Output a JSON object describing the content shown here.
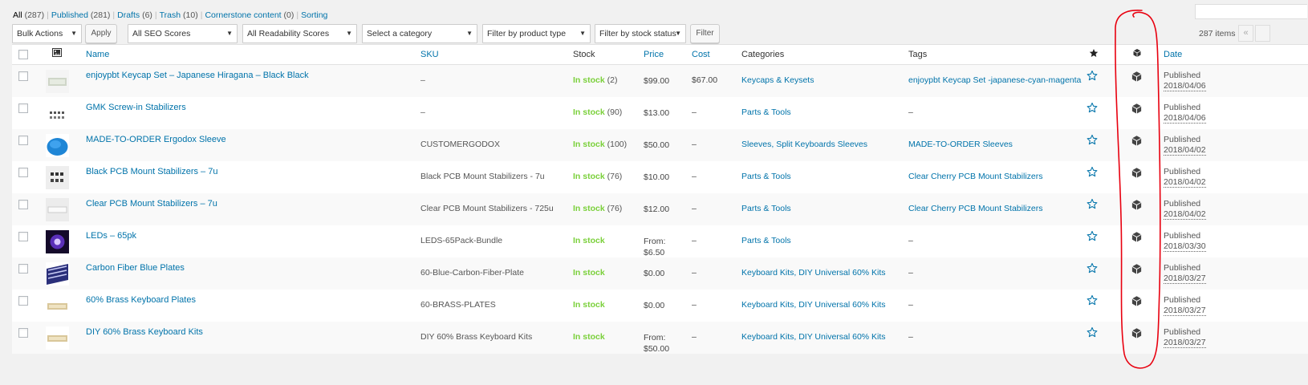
{
  "status_links": [
    {
      "label": "All",
      "count": "(287)",
      "current": true
    },
    {
      "label": "Published",
      "count": "(281)"
    },
    {
      "label": "Drafts",
      "count": "(6)"
    },
    {
      "label": "Trash",
      "count": "(10)"
    },
    {
      "label": "Cornerstone content",
      "count": "(0)"
    },
    {
      "label": "Sorting",
      "count": ""
    }
  ],
  "filters": {
    "bulk_actions": "Bulk Actions",
    "apply": "Apply",
    "seo_scores": "All SEO Scores",
    "readability_scores": "All Readability Scores",
    "category": "Select a category",
    "product_type": "Filter by product type",
    "stock_status": "Filter by stock status",
    "filter": "Filter"
  },
  "pagination": {
    "items_count": "287 items",
    "first": "«"
  },
  "columns": {
    "name": "Name",
    "sku": "SKU",
    "stock": "Stock",
    "price": "Price",
    "cost": "Cost",
    "categories": "Categories",
    "tags": "Tags",
    "date": "Date"
  },
  "icons": {
    "image_column": "image-icon",
    "featured_column": "star-filled-icon",
    "type_column": "product-type-cube-icon",
    "row_featured": "star-outline-icon",
    "row_type": "product-type-cube-icon"
  },
  "colors": {
    "link": "#0073aa",
    "in_stock": "#7ad03a",
    "annotation": "#e8000f"
  },
  "products": [
    {
      "name": "enjoypbt Keycap Set – Japanese Hiragana – Black Black",
      "sku": "–",
      "stock": "In stock",
      "qty": "(2)",
      "price": "$99.00",
      "price2": "",
      "cost": "$67.00",
      "categories": "Keycaps & Keysets",
      "tags": "enjoypbt Keycap Set -japanese-cyan-magenta",
      "date_status": "Published",
      "date": "2018/04/06",
      "thumb": "keycap"
    },
    {
      "name": "GMK Screw-in Stabilizers",
      "sku": "–",
      "stock": "In stock",
      "qty": "(90)",
      "price": "$13.00",
      "price2": "",
      "cost": "–",
      "categories": "Parts & Tools",
      "tags": "–",
      "date_status": "Published",
      "date": "2018/04/06",
      "thumb": "stabs"
    },
    {
      "name": "MADE-TO-ORDER Ergodox Sleeve",
      "sku": "CUSTOMERGODOX",
      "stock": "In stock",
      "qty": "(100)",
      "price": "$50.00",
      "price2": "",
      "cost": "–",
      "categories": "Sleeves, Split Keyboards Sleeves",
      "tags": "MADE-TO-ORDER Sleeves",
      "date_status": "Published",
      "date": "2018/04/02",
      "thumb": "sleeve"
    },
    {
      "name": "Black PCB Mount Stabilizers – 7u",
      "sku": "Black PCB Mount Stabilizers - 7u",
      "stock": "In stock",
      "qty": "(76)",
      "price": "$10.00",
      "price2": "",
      "cost": "–",
      "categories": "Parts & Tools",
      "tags": "Clear Cherry PCB Mount Stabilizers",
      "date_status": "Published",
      "date": "2018/04/02",
      "thumb": "blackstabs"
    },
    {
      "name": "Clear PCB Mount Stabilizers – 7u",
      "sku": "Clear PCB Mount Stabilizers - 725u",
      "stock": "In stock",
      "qty": "(76)",
      "price": "$12.00",
      "price2": "",
      "cost": "–",
      "categories": "Parts & Tools",
      "tags": "Clear Cherry PCB Mount Stabilizers",
      "date_status": "Published",
      "date": "2018/04/02",
      "thumb": "clearstabs"
    },
    {
      "name": "LEDs – 65pk",
      "sku": "LEDS-65Pack-Bundle",
      "stock": "In stock",
      "qty": "",
      "price": "From:",
      "price2": "$6.50",
      "cost": "–",
      "categories": "Parts & Tools",
      "tags": "–",
      "date_status": "Published",
      "date": "2018/03/30",
      "thumb": "led"
    },
    {
      "name": "Carbon Fiber Blue Plates",
      "sku": "60-Blue-Carbon-Fiber-Plate",
      "stock": "In stock",
      "qty": "",
      "price": "$0.00",
      "price2": "",
      "cost": "–",
      "categories": "Keyboard Kits, DIY Universal 60% Kits",
      "tags": "–",
      "date_status": "Published",
      "date": "2018/03/27",
      "thumb": "plate"
    },
    {
      "name": "60% Brass Keyboard Plates",
      "sku": "60-BRASS-PLATES",
      "stock": "In stock",
      "qty": "",
      "price": "$0.00",
      "price2": "",
      "cost": "–",
      "categories": "Keyboard Kits, DIY Universal 60% Kits",
      "tags": "–",
      "date_status": "Published",
      "date": "2018/03/27",
      "thumb": "brass"
    },
    {
      "name": "DIY 60% Brass Keyboard Kits",
      "sku": "DIY 60% Brass Keyboard Kits",
      "stock": "In stock",
      "qty": "",
      "price": "From:",
      "price2": "$50.00",
      "cost": "–",
      "categories": "Keyboard Kits, DIY Universal 60% Kits",
      "tags": "–",
      "date_status": "Published",
      "date": "2018/03/27",
      "thumb": "brass"
    }
  ]
}
